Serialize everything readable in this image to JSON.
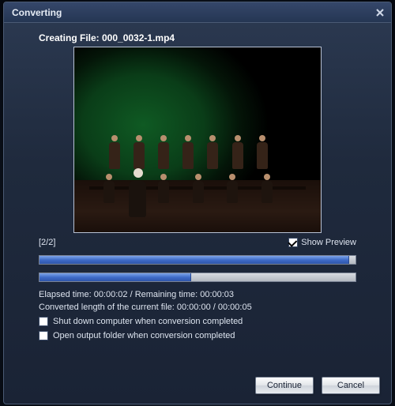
{
  "titlebar": {
    "title": "Converting"
  },
  "creating_label": "Creating File: 000_0032-1.mp4",
  "counter": "[2/2]",
  "show_preview": {
    "label": "Show Preview",
    "checked": true
  },
  "progress": {
    "overall_pct": 98,
    "current_pct": 48
  },
  "elapsed_line": "Elapsed time:  00:00:02 / Remaining time:  00:00:03",
  "converted_line": "Converted length of the current file:  00:00:00 / 00:00:05",
  "options": {
    "shutdown": {
      "label": "Shut down computer when conversion completed",
      "checked": false
    },
    "open_folder": {
      "label": "Open output folder when conversion completed",
      "checked": false
    }
  },
  "buttons": {
    "continue": "Continue",
    "cancel": "Cancel"
  }
}
